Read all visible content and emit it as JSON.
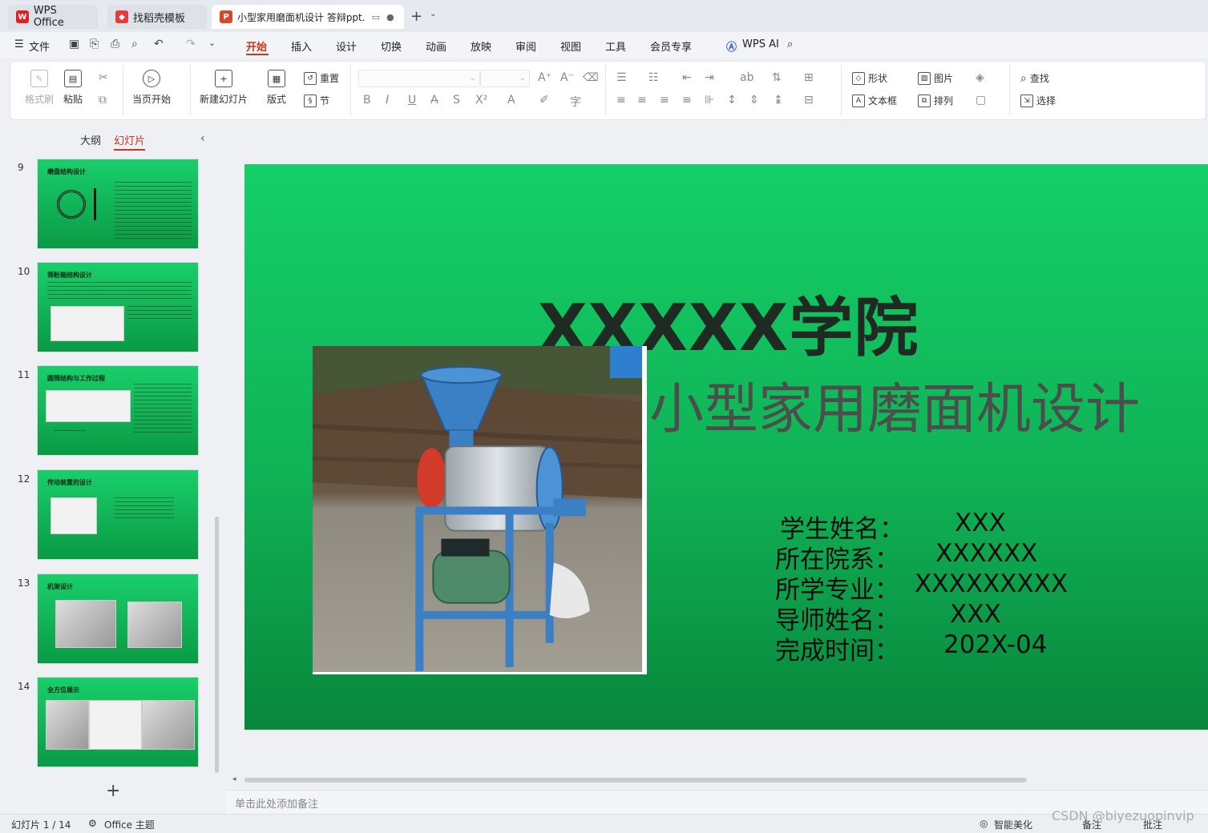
{
  "tabs": {
    "wps_home": "WPS Office",
    "templates": "找稻壳模板",
    "document": "小型家用磨面机设计 答辩ppt.",
    "new_tab": "+",
    "tab_list": "⌄"
  },
  "menu": {
    "file": "文件",
    "items": [
      "开始",
      "插入",
      "设计",
      "切换",
      "动画",
      "放映",
      "审阅",
      "视图",
      "工具",
      "会员专享"
    ],
    "wps_ai": "WPS AI"
  },
  "ribbon": {
    "format_painter": "格式刷",
    "paste": "粘贴",
    "start_from_current": "当页开始",
    "new_slide": "新建幻灯片",
    "layout": "版式",
    "reset": "重置",
    "section": "节",
    "shape": "形状",
    "picture": "图片",
    "textbox": "文本框",
    "arrange": "排列",
    "find": "查找",
    "select": "选择"
  },
  "left_panel": {
    "outline_tab": "大纲",
    "slides_tab": "幻灯片",
    "add_slide": "+",
    "thumbnails": [
      {
        "num": "9",
        "title": "磨盘结构设计"
      },
      {
        "num": "10",
        "title": "筛粉箱结构设计"
      },
      {
        "num": "11",
        "title": "圆筛结构与工作过程"
      },
      {
        "num": "12",
        "title": "传动装置的设计"
      },
      {
        "num": "13",
        "title": "机架设计"
      },
      {
        "num": "14",
        "title": "全方位展示"
      }
    ]
  },
  "slide": {
    "college": "XXXXX学院",
    "title": "小型家用磨面机设计",
    "info": [
      {
        "label": "学生姓名：",
        "value": "XXX"
      },
      {
        "label": "所在院系：",
        "value": "XXXXXX"
      },
      {
        "label": "所学专业：",
        "value": "XXXXXXXXX"
      },
      {
        "label": "导师姓名：",
        "value": "XXX"
      },
      {
        "label": "完成时间：",
        "value": "202X-04"
      }
    ]
  },
  "notes_placeholder": "单击此处添加备注",
  "status": {
    "slide_counter": "幻灯片 1 / 14",
    "theme": "Office 主题",
    "smart_beautify": "智能美化",
    "notes": "备注",
    "comments": "批注"
  },
  "watermark": "CSDN @biyezuopinvip",
  "colors": {
    "accent": "#c8361f",
    "slide_green": "#14cf67"
  }
}
